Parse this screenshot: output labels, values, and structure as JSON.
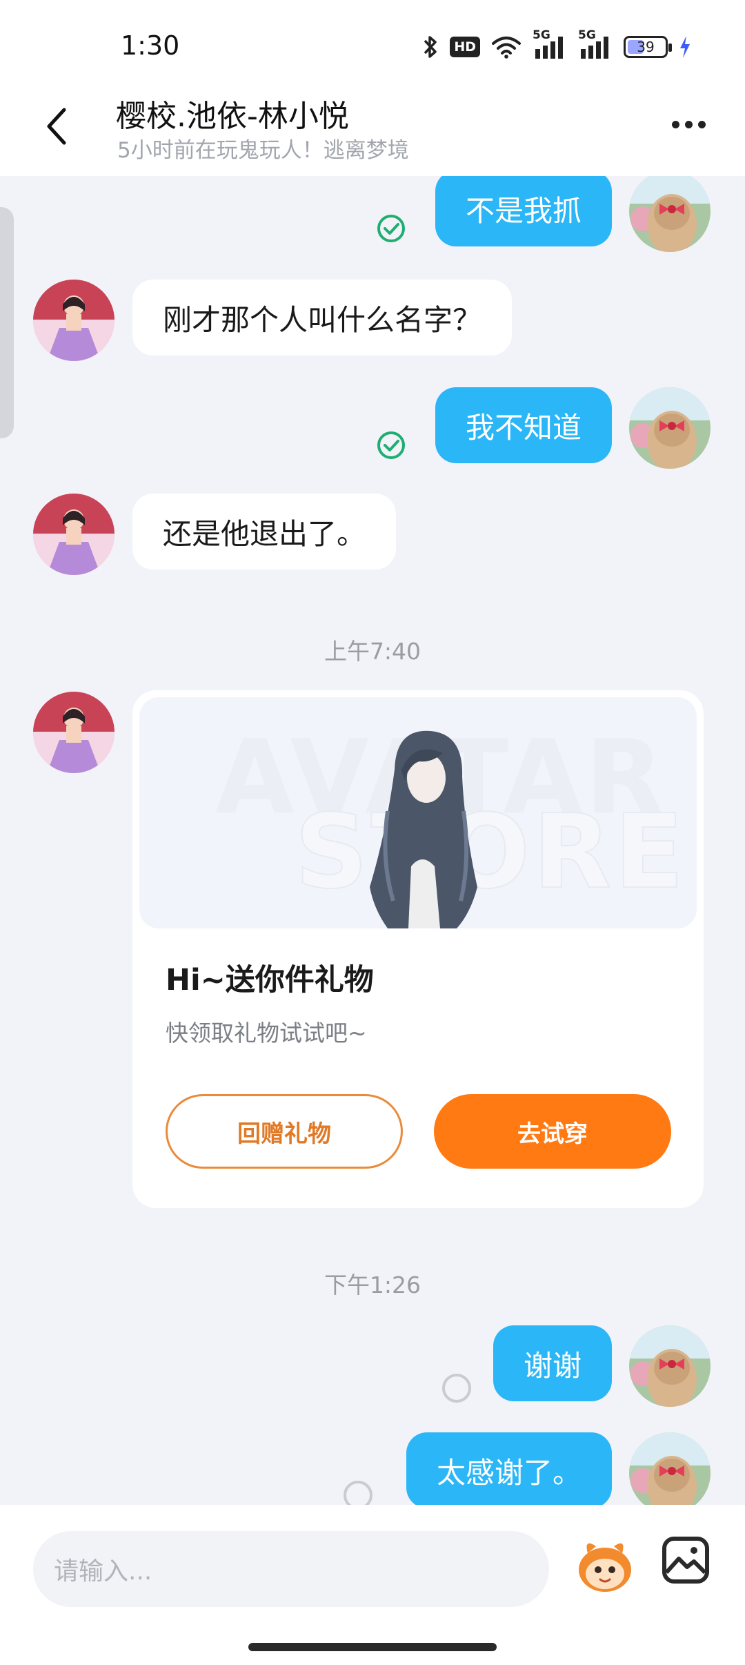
{
  "status_bar": {
    "time": "1:30",
    "battery_level": "39",
    "network_1": "5G",
    "network_2": "5G",
    "hd_label": "HD"
  },
  "header": {
    "title": "樱校.池依-林小悦",
    "subtitle": "5小时前在玩鬼玩人！逃离梦境"
  },
  "messages": [
    {
      "sender": "me",
      "text": "不是我抓",
      "status": "read"
    },
    {
      "sender": "other",
      "text": "刚才那个人叫什么名字？"
    },
    {
      "sender": "me",
      "text": "我不知道",
      "status": "read"
    },
    {
      "sender": "other",
      "text": "还是他退出了。"
    }
  ],
  "timestamps": [
    "上午7:40",
    "下午1:26"
  ],
  "gift_card": {
    "watermark_line1": "AVATAR",
    "watermark_line2": "STORE",
    "title": "Hi~送你件礼物",
    "description": "快领取礼物试试吧~",
    "return_gift_label": "回赠礼物",
    "try_on_label": "去试穿"
  },
  "later_messages": [
    {
      "sender": "me",
      "text": "谢谢",
      "status": "pending"
    },
    {
      "sender": "me",
      "text": "太感谢了。",
      "status": "pending"
    }
  ],
  "input": {
    "placeholder": "请输入..."
  },
  "colors": {
    "my_bubble": "#2ab6f7",
    "accent_orange": "#ff7a12",
    "read_check": "#1fae72",
    "background": "#f1f3f8"
  }
}
